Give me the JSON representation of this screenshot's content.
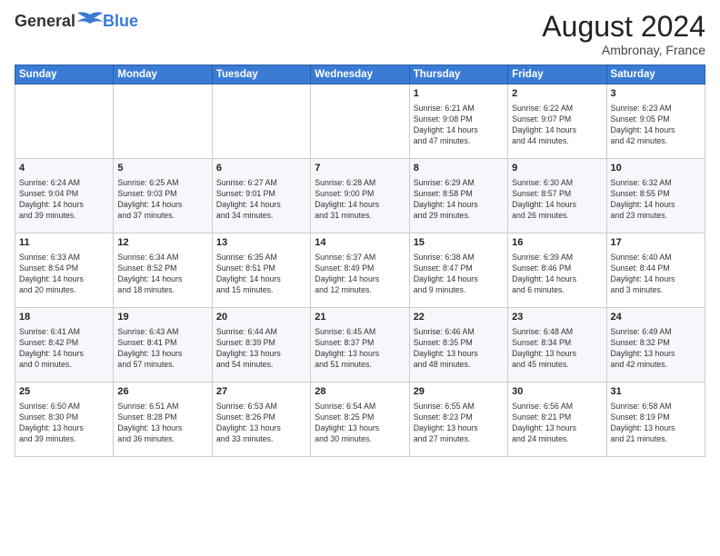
{
  "header": {
    "logo_general": "General",
    "logo_blue": "Blue",
    "month_year": "August 2024",
    "location": "Ambronay, France"
  },
  "weekdays": [
    "Sunday",
    "Monday",
    "Tuesday",
    "Wednesday",
    "Thursday",
    "Friday",
    "Saturday"
  ],
  "weeks": [
    [
      {
        "day": "",
        "info": ""
      },
      {
        "day": "",
        "info": ""
      },
      {
        "day": "",
        "info": ""
      },
      {
        "day": "",
        "info": ""
      },
      {
        "day": "1",
        "info": "Sunrise: 6:21 AM\nSunset: 9:08 PM\nDaylight: 14 hours\nand 47 minutes."
      },
      {
        "day": "2",
        "info": "Sunrise: 6:22 AM\nSunset: 9:07 PM\nDaylight: 14 hours\nand 44 minutes."
      },
      {
        "day": "3",
        "info": "Sunrise: 6:23 AM\nSunset: 9:05 PM\nDaylight: 14 hours\nand 42 minutes."
      }
    ],
    [
      {
        "day": "4",
        "info": "Sunrise: 6:24 AM\nSunset: 9:04 PM\nDaylight: 14 hours\nand 39 minutes."
      },
      {
        "day": "5",
        "info": "Sunrise: 6:25 AM\nSunset: 9:03 PM\nDaylight: 14 hours\nand 37 minutes."
      },
      {
        "day": "6",
        "info": "Sunrise: 6:27 AM\nSunset: 9:01 PM\nDaylight: 14 hours\nand 34 minutes."
      },
      {
        "day": "7",
        "info": "Sunrise: 6:28 AM\nSunset: 9:00 PM\nDaylight: 14 hours\nand 31 minutes."
      },
      {
        "day": "8",
        "info": "Sunrise: 6:29 AM\nSunset: 8:58 PM\nDaylight: 14 hours\nand 29 minutes."
      },
      {
        "day": "9",
        "info": "Sunrise: 6:30 AM\nSunset: 8:57 PM\nDaylight: 14 hours\nand 26 minutes."
      },
      {
        "day": "10",
        "info": "Sunrise: 6:32 AM\nSunset: 8:55 PM\nDaylight: 14 hours\nand 23 minutes."
      }
    ],
    [
      {
        "day": "11",
        "info": "Sunrise: 6:33 AM\nSunset: 8:54 PM\nDaylight: 14 hours\nand 20 minutes."
      },
      {
        "day": "12",
        "info": "Sunrise: 6:34 AM\nSunset: 8:52 PM\nDaylight: 14 hours\nand 18 minutes."
      },
      {
        "day": "13",
        "info": "Sunrise: 6:35 AM\nSunset: 8:51 PM\nDaylight: 14 hours\nand 15 minutes."
      },
      {
        "day": "14",
        "info": "Sunrise: 6:37 AM\nSunset: 8:49 PM\nDaylight: 14 hours\nand 12 minutes."
      },
      {
        "day": "15",
        "info": "Sunrise: 6:38 AM\nSunset: 8:47 PM\nDaylight: 14 hours\nand 9 minutes."
      },
      {
        "day": "16",
        "info": "Sunrise: 6:39 AM\nSunset: 8:46 PM\nDaylight: 14 hours\nand 6 minutes."
      },
      {
        "day": "17",
        "info": "Sunrise: 6:40 AM\nSunset: 8:44 PM\nDaylight: 14 hours\nand 3 minutes."
      }
    ],
    [
      {
        "day": "18",
        "info": "Sunrise: 6:41 AM\nSunset: 8:42 PM\nDaylight: 14 hours\nand 0 minutes."
      },
      {
        "day": "19",
        "info": "Sunrise: 6:43 AM\nSunset: 8:41 PM\nDaylight: 13 hours\nand 57 minutes."
      },
      {
        "day": "20",
        "info": "Sunrise: 6:44 AM\nSunset: 8:39 PM\nDaylight: 13 hours\nand 54 minutes."
      },
      {
        "day": "21",
        "info": "Sunrise: 6:45 AM\nSunset: 8:37 PM\nDaylight: 13 hours\nand 51 minutes."
      },
      {
        "day": "22",
        "info": "Sunrise: 6:46 AM\nSunset: 8:35 PM\nDaylight: 13 hours\nand 48 minutes."
      },
      {
        "day": "23",
        "info": "Sunrise: 6:48 AM\nSunset: 8:34 PM\nDaylight: 13 hours\nand 45 minutes."
      },
      {
        "day": "24",
        "info": "Sunrise: 6:49 AM\nSunset: 8:32 PM\nDaylight: 13 hours\nand 42 minutes."
      }
    ],
    [
      {
        "day": "25",
        "info": "Sunrise: 6:50 AM\nSunset: 8:30 PM\nDaylight: 13 hours\nand 39 minutes."
      },
      {
        "day": "26",
        "info": "Sunrise: 6:51 AM\nSunset: 8:28 PM\nDaylight: 13 hours\nand 36 minutes."
      },
      {
        "day": "27",
        "info": "Sunrise: 6:53 AM\nSunset: 8:26 PM\nDaylight: 13 hours\nand 33 minutes."
      },
      {
        "day": "28",
        "info": "Sunrise: 6:54 AM\nSunset: 8:25 PM\nDaylight: 13 hours\nand 30 minutes."
      },
      {
        "day": "29",
        "info": "Sunrise: 6:55 AM\nSunset: 8:23 PM\nDaylight: 13 hours\nand 27 minutes."
      },
      {
        "day": "30",
        "info": "Sunrise: 6:56 AM\nSunset: 8:21 PM\nDaylight: 13 hours\nand 24 minutes."
      },
      {
        "day": "31",
        "info": "Sunrise: 6:58 AM\nSunset: 8:19 PM\nDaylight: 13 hours\nand 21 minutes."
      }
    ]
  ]
}
